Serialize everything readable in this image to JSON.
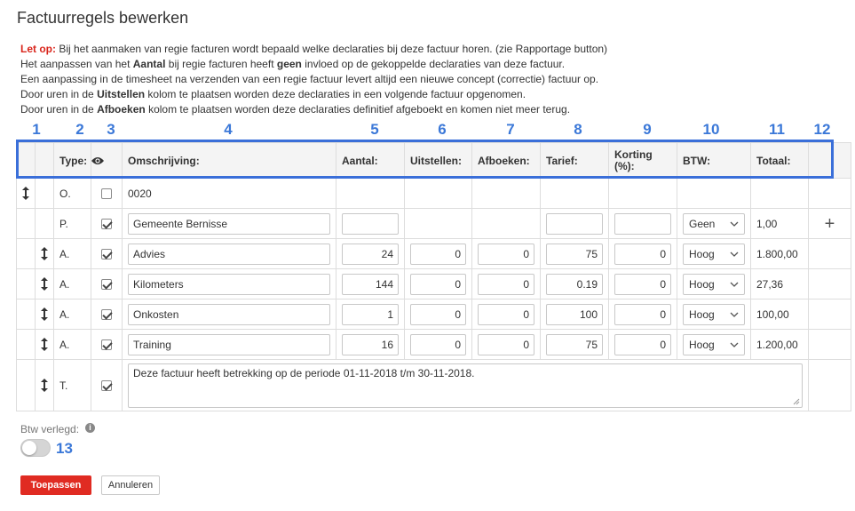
{
  "page": {
    "title": "Factuurregels bewerken"
  },
  "notes": {
    "warn_label": "Let op:",
    "line1": " Bij het aanmaken van regie facturen wordt bepaald welke declaraties bij deze factuur horen. (zie Rapportage button)",
    "line2_a": "Het aanpassen van het ",
    "line2_b": "Aantal",
    "line2_c": " bij regie facturen heeft ",
    "line2_d": "geen",
    "line2_e": " invloed op de gekoppelde declaraties van deze factuur.",
    "line3": "Een aanpassing in de timesheet na verzenden van een regie factuur levert altijd een nieuwe concept (correctie) factuur op.",
    "line4_a": "Door uren in de ",
    "line4_b": "Uitstellen",
    "line4_c": " kolom te plaatsen worden deze declaraties in een volgende factuur opgenomen.",
    "line5_a": "Door uren in de ",
    "line5_b": "Afboeken",
    "line5_c": " kolom te plaatsen worden deze declaraties definitief afgeboekt en komen niet meer terug."
  },
  "annotations": [
    "1",
    "2",
    "3",
    "4",
    "5",
    "6",
    "7",
    "8",
    "9",
    "10",
    "11",
    "12",
    "13"
  ],
  "columns": {
    "type": "Type:",
    "omschrijving": "Omschrijving:",
    "aantal": "Aantal:",
    "uitstellen": "Uitstellen:",
    "afboeken": "Afboeken:",
    "tarief": "Tarief:",
    "korting": "Korting (%):",
    "btw": "BTW:",
    "totaal": "Totaal:"
  },
  "rows": {
    "o": {
      "type": "O.",
      "omschrijving": "0020",
      "checked": false
    },
    "p": {
      "type": "P.",
      "omschrijving": "Gemeente Bernisse",
      "aantal": "",
      "tarief": "",
      "korting": "",
      "btw": "Geen",
      "totaal": "1,00",
      "checked": true
    },
    "a1": {
      "type": "A.",
      "omschrijving": "Advies",
      "aantal": "24",
      "uitstellen": "0",
      "afboeken": "0",
      "tarief": "75",
      "korting": "0",
      "btw": "Hoog",
      "totaal": "1.800,00",
      "checked": true
    },
    "a2": {
      "type": "A.",
      "omschrijving": "Kilometers",
      "aantal": "144",
      "uitstellen": "0",
      "afboeken": "0",
      "tarief": "0.19",
      "korting": "0",
      "btw": "Hoog",
      "totaal": "27,36",
      "checked": true
    },
    "a3": {
      "type": "A.",
      "omschrijving": "Onkosten",
      "aantal": "1",
      "uitstellen": "0",
      "afboeken": "0",
      "tarief": "100",
      "korting": "0",
      "btw": "Hoog",
      "totaal": "100,00",
      "checked": true
    },
    "a4": {
      "type": "A.",
      "omschrijving": "Training",
      "aantal": "16",
      "uitstellen": "0",
      "afboeken": "0",
      "tarief": "75",
      "korting": "0",
      "btw": "Hoog",
      "totaal": "1.200,00",
      "checked": true
    },
    "t": {
      "type": "T.",
      "text": "Deze factuur heeft betrekking op de periode 01-11-2018 t/m 30-11-2018.",
      "checked": true
    }
  },
  "footer": {
    "btw_label": "Btw verlegd:",
    "info_glyph": "i",
    "apply_button": "Toepassen",
    "cancel_button": "Annuleren"
  },
  "colors": {
    "accent_blue": "#3b78d8",
    "primary_red": "#e02b22",
    "warn_red": "#d9261c"
  },
  "icons": [
    "drag-handle-icon",
    "eye-icon",
    "chevron-down-icon",
    "plus-icon",
    "info-icon",
    "checkbox-icon"
  ]
}
